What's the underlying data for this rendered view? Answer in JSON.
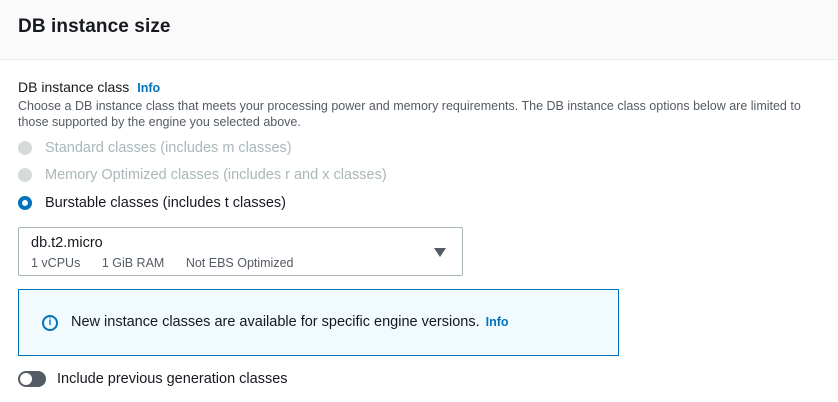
{
  "header": {
    "title": "DB instance size"
  },
  "instance_class": {
    "label": "DB instance class",
    "info_label": "Info",
    "description": "Choose a DB instance class that meets your processing power and memory requirements. The DB instance class options below are limited to those supported by the engine you selected above.",
    "options": [
      {
        "label": "Standard classes (includes m classes)",
        "state": "disabled"
      },
      {
        "label": "Memory Optimized classes (includes r and x classes)",
        "state": "disabled"
      },
      {
        "label": "Burstable classes (includes t classes)",
        "state": "selected"
      }
    ]
  },
  "select": {
    "value": "db.t2.micro",
    "vcpus": "1 vCPUs",
    "ram": "1 GiB RAM",
    "ebs": "Not EBS Optimized",
    "icon": "caret-down-icon"
  },
  "alert": {
    "icon": "info-circle-icon",
    "icon_glyph": "i",
    "message": "New instance classes are available for specific engine versions.",
    "info_label": "Info",
    "border_color": "#0073bb",
    "background_color": "#f1faff"
  },
  "toggle": {
    "label": "Include previous generation classes",
    "checked": false
  },
  "colors": {
    "accent": "#0073bb",
    "text": "#16191f",
    "secondary_text": "#545b64",
    "disabled_text": "#aab7b8"
  }
}
